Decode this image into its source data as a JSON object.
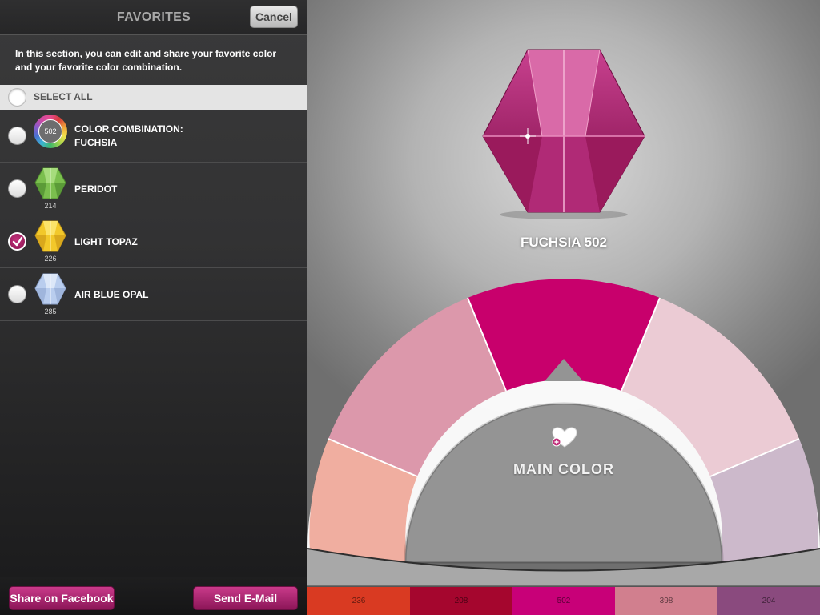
{
  "panel": {
    "title": "FAVORITES",
    "cancel_label": "Cancel",
    "intro": "In this section, you can edit and share your favorite color and your favorite color combination.",
    "select_all_label": "SELECT ALL",
    "items": [
      {
        "name_line1": "COLOR COMBINATION:",
        "name_line2": "FUCHSIA",
        "number": "502",
        "checked": false,
        "icon": "color-wheel-icon"
      },
      {
        "name": "PERIDOT",
        "number": "214",
        "checked": false,
        "color": "#7bbf4e",
        "icon": "crystal-icon"
      },
      {
        "name": "LIGHT TOPAZ",
        "number": "226",
        "checked": true,
        "color": "#f2c82a",
        "icon": "crystal-icon"
      },
      {
        "name": "AIR BLUE OPAL",
        "number": "285",
        "checked": false,
        "color": "#b9cdee",
        "icon": "crystal-icon"
      }
    ],
    "share_facebook_label": "Share on Facebook",
    "send_email_label": "Send E-Mail"
  },
  "main": {
    "crystal_name": "FUCHSIA 502",
    "crystal_color": "#b8186f",
    "main_color_label": "MAIN COLOR",
    "wheel_segments": [
      {
        "color": "#f0aea0"
      },
      {
        "color": "#dc98ab"
      },
      {
        "color": "#c8006c"
      },
      {
        "color": "#ebcbd4"
      },
      {
        "color": "#ccb9cb"
      }
    ],
    "swatches": [
      {
        "number": "236",
        "color": "#d93a22"
      },
      {
        "number": "208",
        "color": "#a5062e"
      },
      {
        "number": "502",
        "color": "#c80078"
      },
      {
        "number": "398",
        "color": "#d17f8e"
      },
      {
        "number": "204",
        "color": "#8a4a7e"
      }
    ]
  },
  "colors": {
    "accent_pink": "#b3257a",
    "panel_bg": "#333334"
  }
}
